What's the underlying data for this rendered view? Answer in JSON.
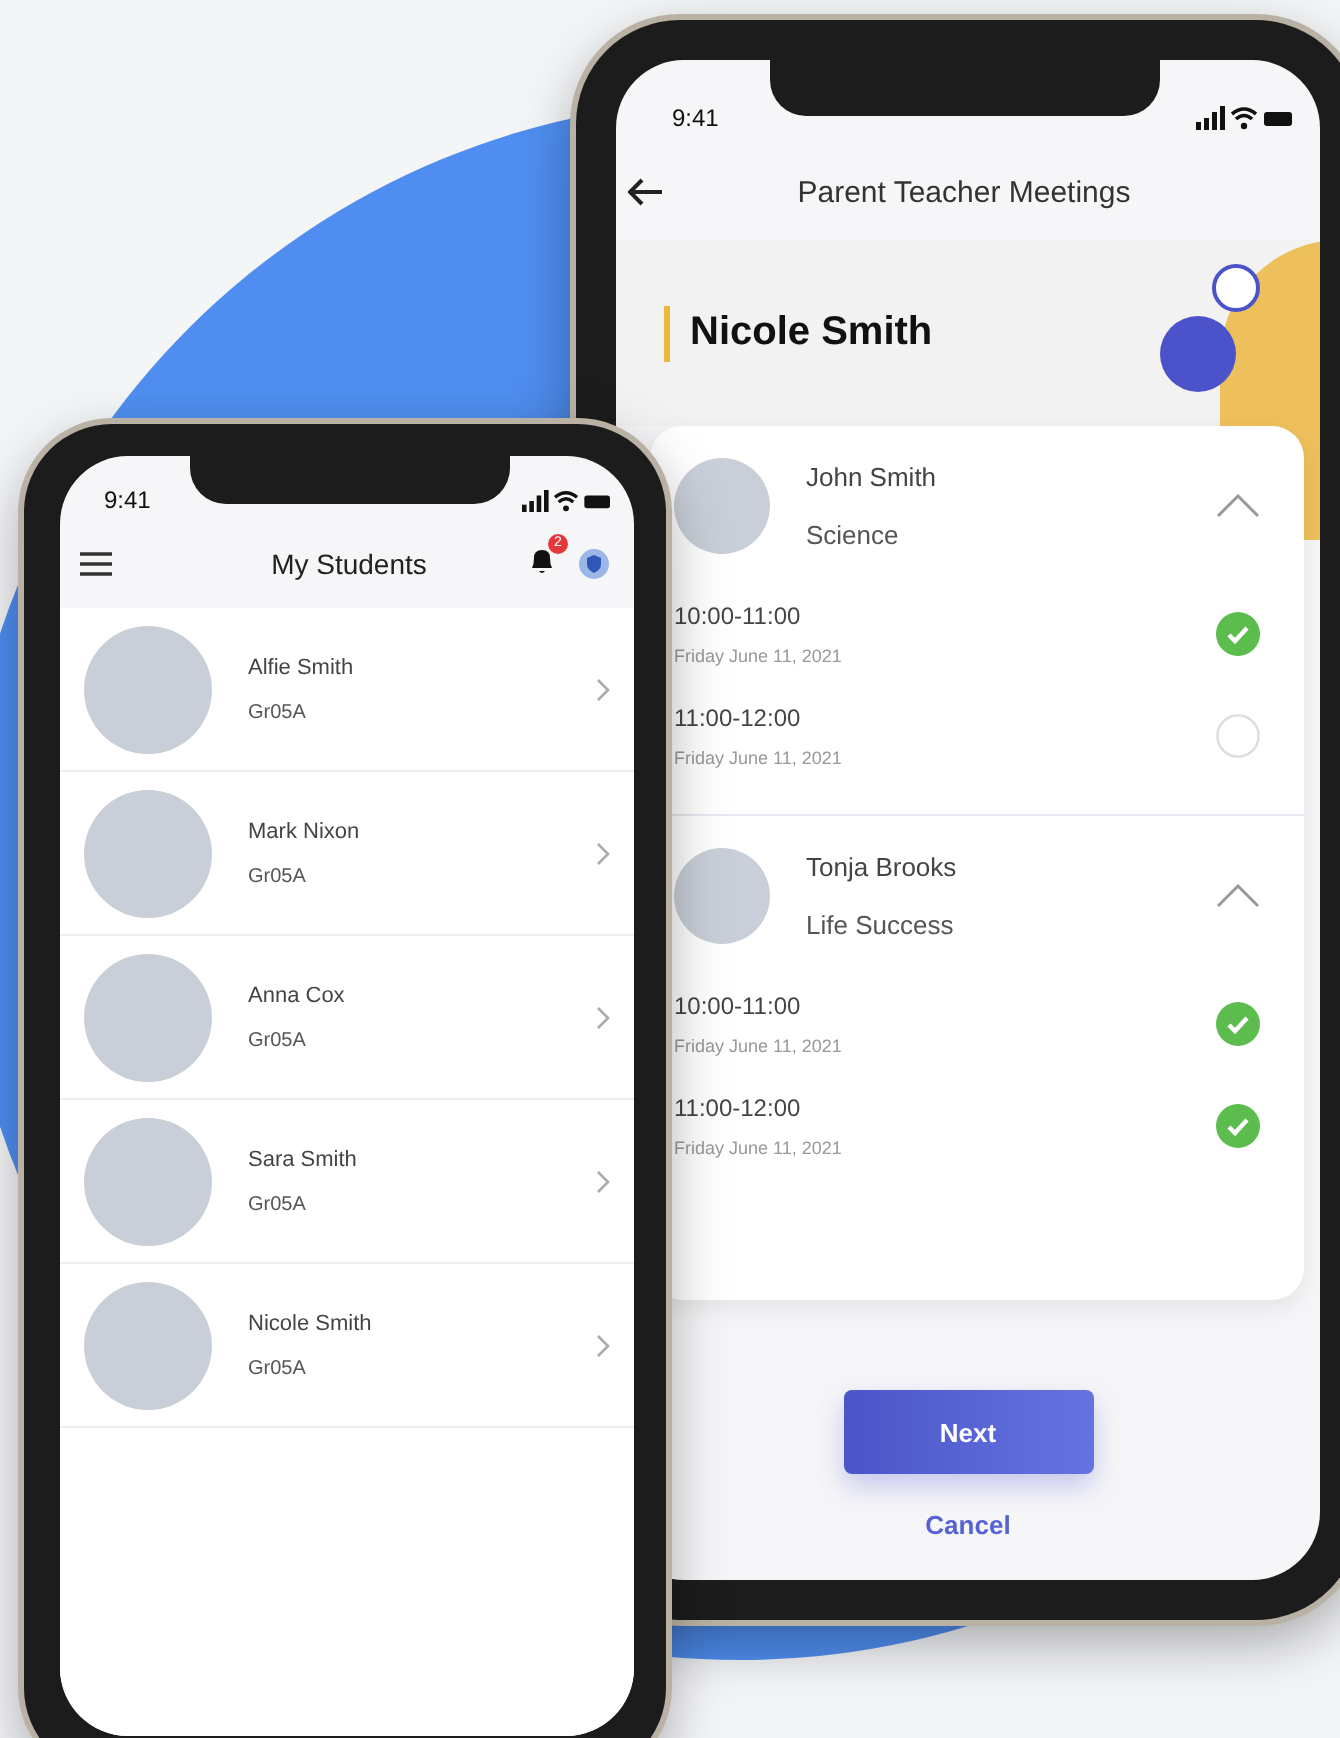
{
  "students_phone": {
    "status_time": "9:41",
    "title": "My Students",
    "notification_count": "2",
    "students": [
      {
        "name": "Alfie Smith",
        "grade": "Gr05A"
      },
      {
        "name": "Mark Nixon",
        "grade": "Gr05A"
      },
      {
        "name": "Anna Cox",
        "grade": "Gr05A"
      },
      {
        "name": "Sara Smith",
        "grade": "Gr05A"
      },
      {
        "name": "Nicole Smith",
        "grade": "Gr05A"
      }
    ]
  },
  "meetings_phone": {
    "status_time": "9:41",
    "title": "Parent Teacher Meetings",
    "student_name": "Nicole Smith",
    "teachers": [
      {
        "name": "John Smith",
        "subject": "Science",
        "expanded": true,
        "slots": [
          {
            "time": "10:00-11:00",
            "date": "Friday June 11, 2021",
            "selected": true
          },
          {
            "time": "11:00-12:00",
            "date": "Friday June 11, 2021",
            "selected": false
          }
        ]
      },
      {
        "name": "Tonja Brooks",
        "subject": "Life Success",
        "expanded": true,
        "slots": [
          {
            "time": "10:00-11:00",
            "date": "Friday June 11, 2021",
            "selected": true
          },
          {
            "time": "11:00-12:00",
            "date": "Friday June 11, 2021",
            "selected": true
          }
        ]
      }
    ],
    "next_button": "Next",
    "cancel_link": "Cancel"
  }
}
